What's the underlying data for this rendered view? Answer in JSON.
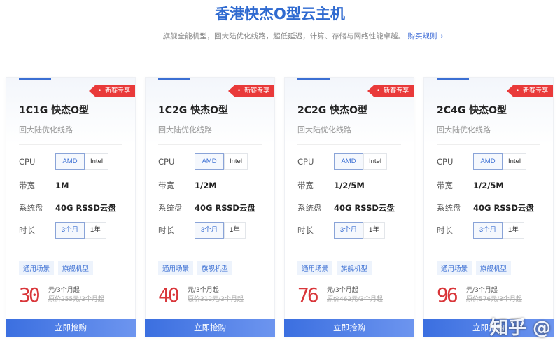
{
  "header": {
    "title": "香港快杰O型云主机",
    "subtitle": "旗舰全能机型，回大陆优化线路，超低延迟，计算、存储与网络性能卓越。",
    "rules_link": "购买规则→"
  },
  "labels": {
    "cpu": "CPU",
    "bandwidth": "带宽",
    "disk": "系统盘",
    "duration": "时长",
    "badge": "新客专享",
    "buy": "立即抢购"
  },
  "cards": [
    {
      "name": "1C1G 快杰O型",
      "line": "回大陆优化线路",
      "cpu_options": [
        "AMD",
        "Intel"
      ],
      "bandwidth": "1M",
      "disk": "40G RSSD云盘",
      "durations": [
        "3个月",
        "1年"
      ],
      "tags": [
        "通用场景",
        "旗舰机型"
      ],
      "price": "30",
      "unit": "元/3个月起",
      "original": "原价255元/3个月起"
    },
    {
      "name": "1C2G 快杰O型",
      "line": "回大陆优化线路",
      "cpu_options": [
        "AMD",
        "Intel"
      ],
      "bandwidth": "1/2M",
      "disk": "40G RSSD云盘",
      "durations": [
        "3个月",
        "1年"
      ],
      "tags": [
        "通用场景",
        "旗舰机型"
      ],
      "price": "40",
      "unit": "元/3个月起",
      "original": "原价312元/3个月起"
    },
    {
      "name": "2C2G 快杰O型",
      "line": "回大陆优化线路",
      "cpu_options": [
        "AMD",
        "Intel"
      ],
      "bandwidth": "1/2/5M",
      "disk": "40G RSSD云盘",
      "durations": [
        "3个月",
        "1年"
      ],
      "tags": [
        "通用场景",
        "旗舰机型"
      ],
      "price": "76",
      "unit": "元/3个月起",
      "original": "原价462元/3个月起"
    },
    {
      "name": "2C4G 快杰O型",
      "line": "回大陆优化线路",
      "cpu_options": [
        "AMD",
        "Intel"
      ],
      "bandwidth": "1/2/5M",
      "disk": "40G RSSD云盘",
      "durations": [
        "3个月",
        "1年"
      ],
      "tags": [
        "通用场景",
        "旗舰机型"
      ],
      "price": "96",
      "unit": "元/3个月起",
      "original": "原价576元/3个月起"
    }
  ],
  "watermark": "知乎 @",
  "colors": {
    "accent": "#3b6fd3",
    "badge": "#e93a3a",
    "price": "#d9363a"
  }
}
